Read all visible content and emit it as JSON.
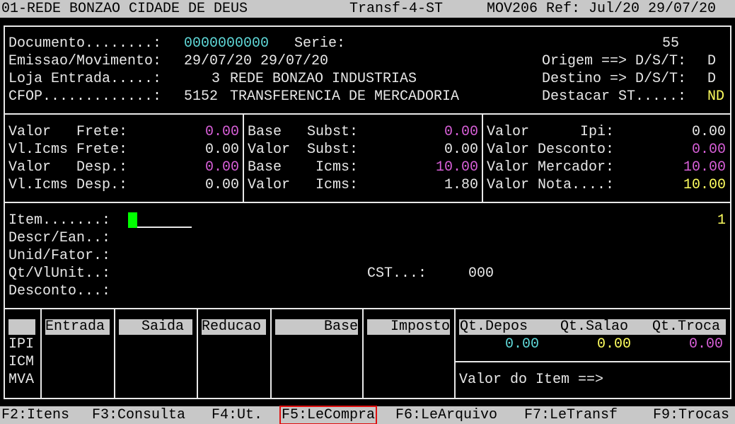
{
  "title_bar": {
    "company": "01-REDE BONZAO CIDADE DE DEUS",
    "screen": "Transf-4-ST",
    "program": "MOV206 Ref: Jul/20 29/07/20"
  },
  "header": {
    "documento_label": "Documento........:",
    "documento_value": "0000000000",
    "serie_label": "Serie:",
    "serie_value": "55",
    "emissao_label": "Emissao/Movimento:",
    "emissao_value": "29/07/20 29/07/20",
    "loja_label": "Loja Entrada.....:",
    "loja_code": "3",
    "loja_name": "REDE BONZAO INDUSTRIAS",
    "cfop_label": "CFOP.............:",
    "cfop_code": "5152",
    "cfop_desc": "TRANSFERENCIA DE MERCADORIA",
    "origem_label": "Origem ==> D/S/T:",
    "origem_value": "D",
    "destino_label": "Destino => D/S/T:",
    "destino_value": "D",
    "destacar_label": "Destacar ST.....:",
    "destacar_value": "ND"
  },
  "totals": {
    "col1": [
      {
        "label": "Valor   Frete:",
        "value": "0.00",
        "color": "#d75fd7"
      },
      {
        "label": "Vl.Icms Frete:",
        "value": "0.00",
        "color": "#e8e8e8"
      },
      {
        "label": "Valor   Desp.:",
        "value": "0.00",
        "color": "#d75fd7"
      },
      {
        "label": "Vl.Icms Desp.:",
        "value": "0.00",
        "color": "#e8e8e8"
      }
    ],
    "col2": [
      {
        "label": "Base   Subst:",
        "value": "0.00",
        "color": "#d75fd7"
      },
      {
        "label": "Valor  Subst:",
        "value": "0.00",
        "color": "#e8e8e8"
      },
      {
        "label": "Base    Icms:",
        "value": "10.00",
        "color": "#d75fd7"
      },
      {
        "label": "Valor   Icms:",
        "value": "1.80",
        "color": "#e8e8e8"
      }
    ],
    "col3": [
      {
        "label": "Valor      Ipi:",
        "value": "0.00",
        "color": "#e8e8e8"
      },
      {
        "label": "Valor Desconto:",
        "value": "0.00",
        "color": "#d75fd7"
      },
      {
        "label": "Valor Mercador:",
        "value": "10.00",
        "color": "#d75fd7"
      },
      {
        "label": "Valor Nota....:",
        "value": "10.00",
        "color": "#ffff5f"
      }
    ]
  },
  "item": {
    "item_label": "Item.......:",
    "item_count": "1",
    "descr_label": "Descr/Ean..:",
    "unid_label": "Unid/Fator.:",
    "qt_label": "Qt/VlUnit..:",
    "cst_label": "CST...:",
    "cst_value": "000",
    "desconto_label": "Desconto...:"
  },
  "tax_table": {
    "headers": {
      "entrada": "Entrada",
      "saida": "Saida",
      "reducao": "Reducao",
      "base": "Base",
      "imposto": "Imposto"
    },
    "rows": [
      "IPI",
      "ICM",
      "MVA"
    ]
  },
  "stock": {
    "h_depos": "Qt.Depos",
    "h_salao": "Qt.Salao",
    "h_troca": "Qt.Troca",
    "depos": "0.00",
    "salao": "0.00",
    "troca": "0.00",
    "valor_item_label": "Valor do Item ==>"
  },
  "function_keys": [
    "F2:Itens",
    "F3:Consulta",
    "F4:Ut.",
    "F5:LeCompra",
    "F6:LeArquivo",
    "F7:LeTransf",
    "F9:Trocas"
  ]
}
